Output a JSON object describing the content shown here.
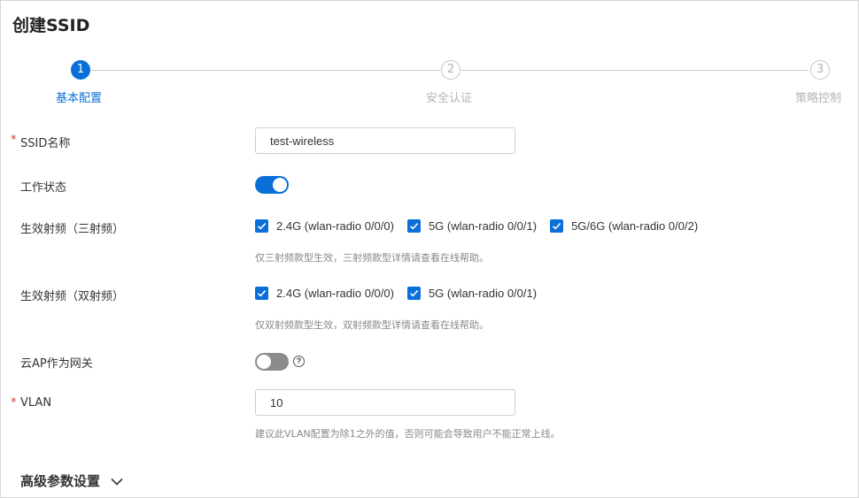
{
  "page": {
    "title": "创建SSID"
  },
  "steps": [
    {
      "number": "1",
      "label": "基本配置",
      "state": "active"
    },
    {
      "number": "2",
      "label": "安全认证",
      "state": "inactive"
    },
    {
      "number": "3",
      "label": "策略控制",
      "state": "inactive"
    }
  ],
  "form": {
    "required_mark": "*",
    "ssid_name": {
      "label": "SSID名称",
      "value": "test-wireless"
    },
    "work_status": {
      "label": "工作状态",
      "on": true
    },
    "radio_tri": {
      "label": "生效射频（三射频）",
      "options": [
        {
          "text": "2.4G (wlan-radio 0/0/0)",
          "checked": true
        },
        {
          "text": "5G (wlan-radio 0/0/1)",
          "checked": true
        },
        {
          "text": "5G/6G (wlan-radio 0/0/2)",
          "checked": true
        }
      ],
      "hint": "仅三射频款型生效，三射频款型详情请查看在线帮助。"
    },
    "radio_dual": {
      "label": "生效射频（双射频）",
      "options": [
        {
          "text": "2.4G (wlan-radio 0/0/0)",
          "checked": true
        },
        {
          "text": "5G (wlan-radio 0/0/1)",
          "checked": true
        }
      ],
      "hint": "仅双射频款型生效，双射频款型详情请查看在线帮助。"
    },
    "cloud_ap_gateway": {
      "label": "云AP作为网关",
      "on": false,
      "help_icon": "question-circle-icon",
      "help_glyph": "?"
    },
    "vlan": {
      "label": "VLAN",
      "value": "10",
      "hint": "建议此VLAN配置为除1之外的值，否则可能会导致用户不能正常上线。"
    }
  },
  "advanced": {
    "label": "高级参数设置",
    "icon": "chevron-down-icon"
  },
  "colors": {
    "accent": "#0a6fd8",
    "required": "#e0362b",
    "toggle_off": "#8c8c8c"
  }
}
